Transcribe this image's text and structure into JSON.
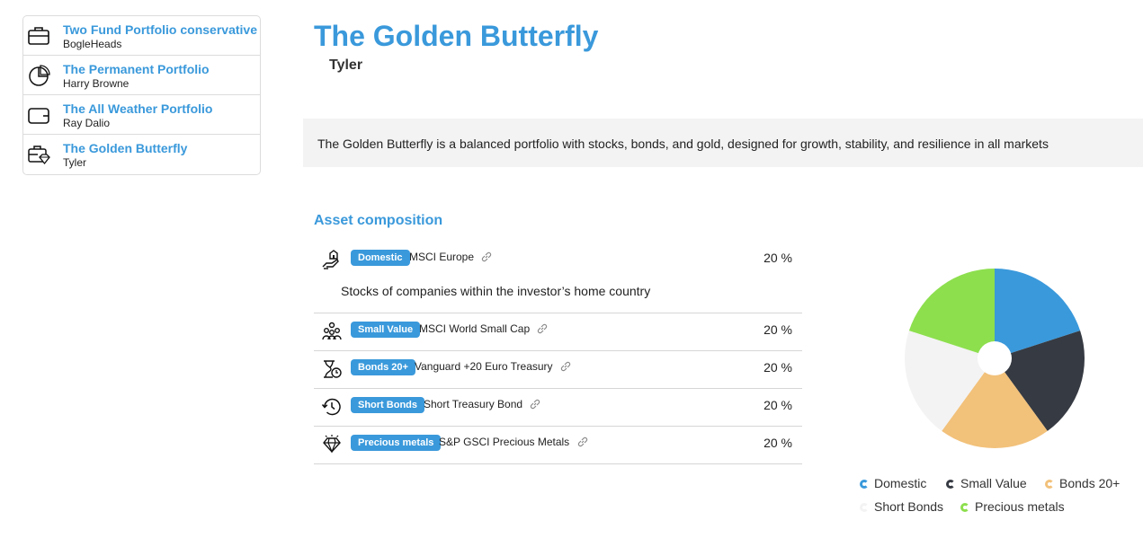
{
  "sidebar": {
    "items": [
      {
        "title": "Two Fund Portfolio conservative",
        "subtitle": "BogleHeads",
        "icon": "briefcase-icon"
      },
      {
        "title": "The Permanent Portfolio",
        "subtitle": "Harry Browne",
        "icon": "pie-chart-icon"
      },
      {
        "title": "The All Weather Portfolio",
        "subtitle": "Ray Dalio",
        "icon": "wallet-icon"
      },
      {
        "title": "The Golden Butterfly",
        "subtitle": "Tyler",
        "icon": "briefcase-diamond-icon"
      }
    ]
  },
  "portfolio": {
    "title": "The Golden Butterfly",
    "author": "Tyler",
    "description": "The Golden Butterfly is a balanced portfolio with stocks, bonds, and gold, designed for growth, stability, and resilience in all markets"
  },
  "composition": {
    "heading": "Asset composition",
    "assets": [
      {
        "badge": "Domestic",
        "name": "MSCI Europe",
        "percent": "20 %",
        "icon": "domestic-hand-icon",
        "description": "Stocks of companies within the investor’s home country"
      },
      {
        "badge": "Small Value",
        "name": "MSCI World Small Cap",
        "percent": "20 %",
        "icon": "people-group-icon"
      },
      {
        "badge": "Bonds 20+",
        "name": "Vanguard +20 Euro Treasury",
        "percent": "20 %",
        "icon": "hourglass-clock-icon"
      },
      {
        "badge": "Short Bonds",
        "name": "Short Treasury Bond",
        "percent": "20 %",
        "icon": "clock-history-icon"
      },
      {
        "badge": "Precious metals",
        "name": "S&P GSCI Precious Metals",
        "percent": "20 %",
        "icon": "diamond-icon"
      }
    ]
  },
  "colors": {
    "accent": "#3a99db",
    "domestic": "#3a99db",
    "small_value": "#363a42",
    "bonds_20": "#f2c17a",
    "short_bonds": "#f3f3f3",
    "precious_metals": "#8ddf4e"
  },
  "chart_data": {
    "type": "pie",
    "donut": true,
    "categories": [
      "Domestic",
      "Small Value",
      "Bonds 20+",
      "Short Bonds",
      "Precious metals"
    ],
    "values": [
      20,
      20,
      20,
      20,
      20
    ],
    "colors": [
      "#3a99db",
      "#363a42",
      "#f2c17a",
      "#f3f3f3",
      "#8ddf4e"
    ],
    "legend_position": "bottom"
  }
}
